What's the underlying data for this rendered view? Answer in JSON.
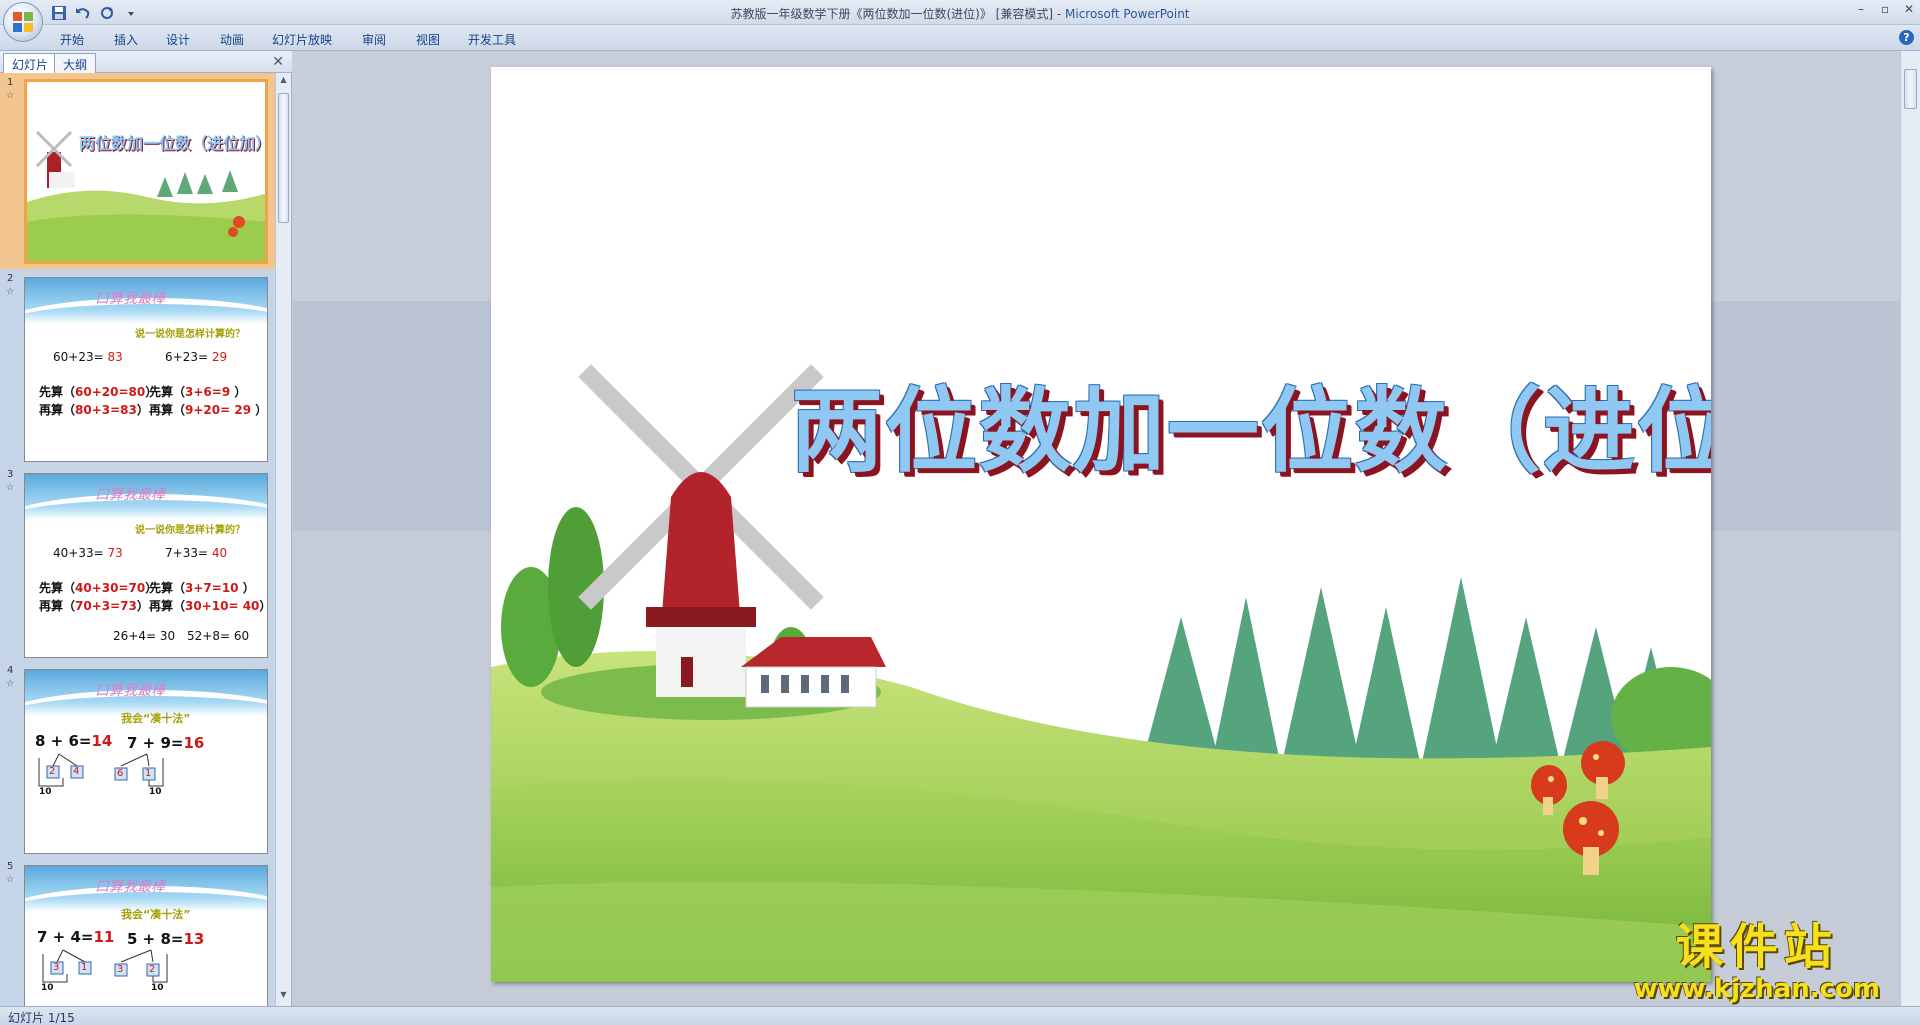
{
  "window": {
    "title": "苏教版一年级数学下册《两位数加一位数(进位)》 [兼容模式] - ",
    "app_name": "Microsoft PowerPoint"
  },
  "ribbon": {
    "tabs": [
      "开始",
      "插入",
      "设计",
      "动画",
      "幻灯片放映",
      "审阅",
      "视图",
      "开发工具"
    ]
  },
  "left_panel": {
    "tabs": [
      "幻灯片",
      "大纲"
    ],
    "active_tab": "幻灯片"
  },
  "thumbnails": [
    {
      "num": "1",
      "title": "两位数加一位数（进位加）"
    },
    {
      "num": "2",
      "heading": "口算我最棒",
      "subtitle": "说一说你是怎样计算的？",
      "lines": [
        {
          "a": "60+23=",
          "ar": "83",
          "b": "6+23=",
          "br": "29"
        },
        {
          "a": "先算（",
          "ar": "60+20=80",
          "b": "先算（",
          "br": "3+6=9"
        },
        {
          "a": "再算（",
          "ar": "80+3=83",
          "b": "再算（",
          "br": "9+20= 29"
        }
      ]
    },
    {
      "num": "3",
      "heading": "口算我最棒",
      "subtitle": "说一说你是怎样计算的？",
      "lines": [
        {
          "a": "40+33=",
          "ar": "73",
          "b": "7+33=",
          "br": "40"
        },
        {
          "a": "先算（",
          "ar": "40+30=70",
          "b": "先算（",
          "br": "3+7=10"
        },
        {
          "a": "再算（",
          "ar": "70+3=73",
          "b": "再算（",
          "br": "30+10= 40"
        }
      ],
      "extra": [
        "26+4= 30",
        "52+8= 60"
      ]
    },
    {
      "num": "4",
      "heading": "口算我最棒",
      "subtitle": "我会“凑十法”",
      "eq1": "8 + 6=",
      "eq1r": "14",
      "eq2": "7 + 9=",
      "eq2r": "16",
      "boxes": [
        "2",
        "4",
        "6",
        "1"
      ],
      "tens": [
        "10",
        "10"
      ]
    },
    {
      "num": "5",
      "heading": "口算我最棒",
      "subtitle": "我会“凑十法”",
      "eq1": "7 + 4=",
      "eq1r": "11",
      "eq2": "5 + 8=",
      "eq2r": "13",
      "boxes": [
        "3",
        "1",
        "3",
        "2"
      ],
      "tens": [
        "10",
        "10"
      ]
    }
  ],
  "slide": {
    "title": "两位数加一位数（进位加）"
  },
  "watermark": {
    "text": "课件站",
    "url": "www.kjzhan.com"
  },
  "status": {
    "text": "幻灯片 1/15"
  },
  "colors": {
    "ribbon_text": "#15428b",
    "title_fill": "#8fc8f3",
    "title_shadow": "#8b1420",
    "selected_thumb": "#f0a44a",
    "answer_red": "#d01818"
  }
}
